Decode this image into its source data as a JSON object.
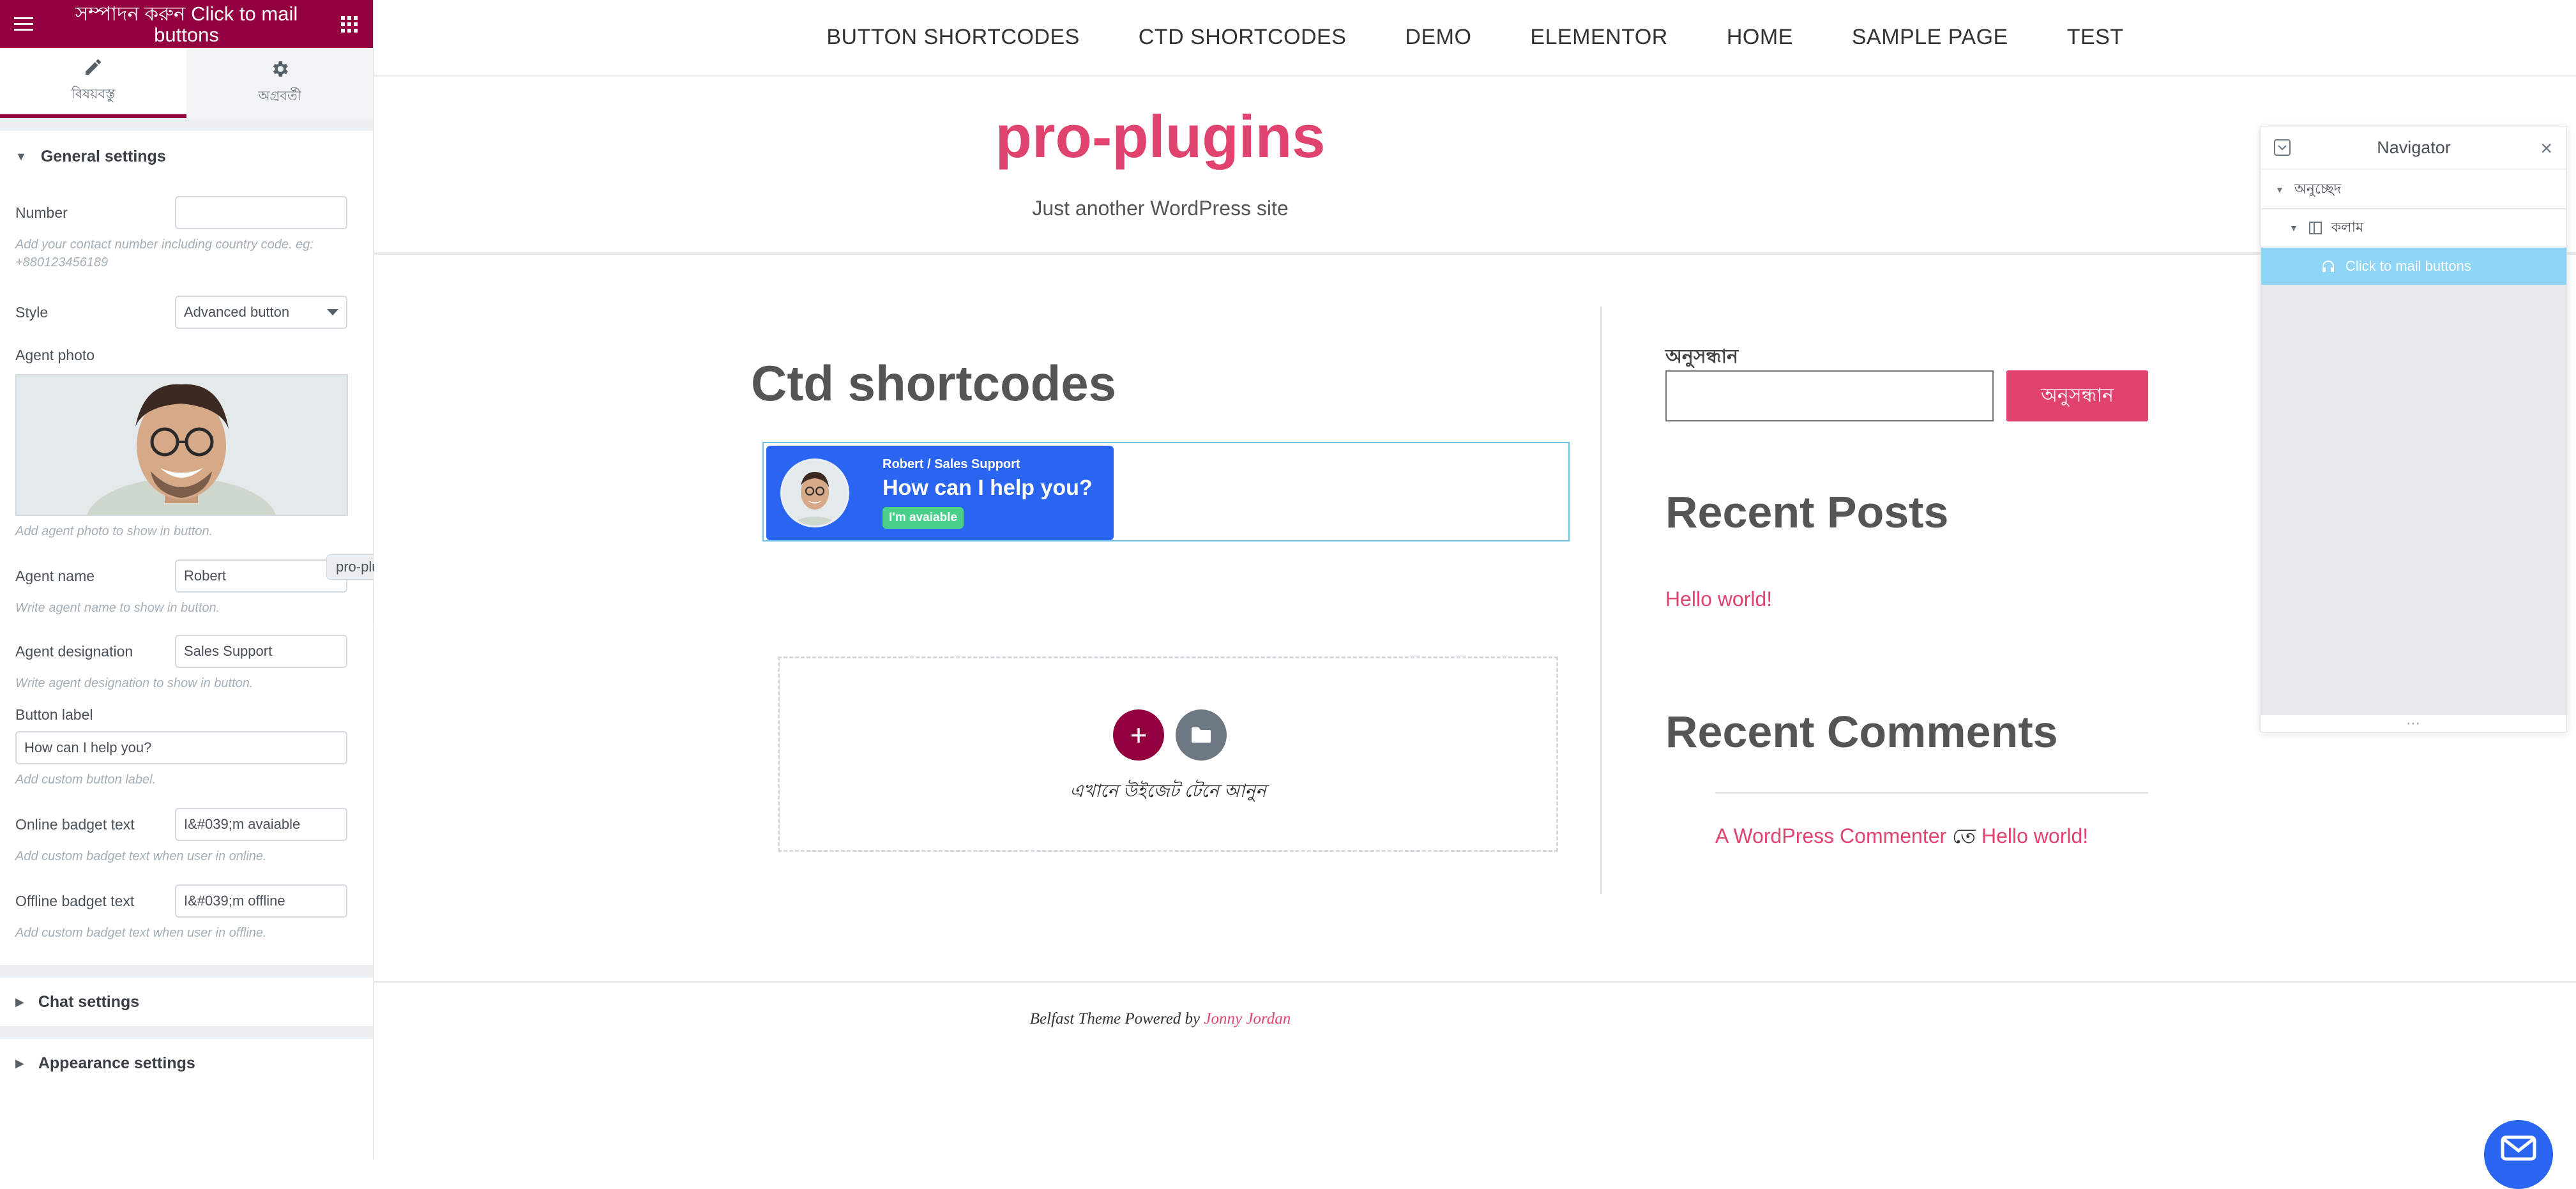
{
  "panel": {
    "title": "সম্পাদন করুন Click to mail buttons",
    "tabs": [
      {
        "label": "বিষয়বস্তু",
        "icon": "pencil-icon"
      },
      {
        "label": "অগ্রবর্তী",
        "icon": "gear-icon"
      }
    ],
    "general_section": "General settings",
    "fields": {
      "number_label": "Number",
      "number_value": "",
      "number_desc": "Add your contact number including country code. eg: +880123456189",
      "style_label": "Style",
      "style_value": "Advanced button",
      "agent_photo_label": "Agent photo",
      "agent_photo_desc": "Add agent photo to show in button.",
      "agent_name_label": "Agent name",
      "agent_name_value": "Robert",
      "agent_name_desc": "Write agent name to show in button.",
      "agent_designation_label": "Agent designation",
      "agent_designation_value": "Sales Support",
      "agent_designation_desc": "Write agent designation to show in button.",
      "button_label_label": "Button label",
      "button_label_value": "How can I help you?",
      "button_label_desc": "Add custom button label.",
      "online_label": "Online badget text",
      "online_value": "I&#039;m avaiable",
      "online_desc": "Add custom badget text when user in online.",
      "offline_label": "Offline badget text",
      "offline_value": "I&#039;m offline",
      "offline_desc": "Add custom badget text when user in offline."
    },
    "chat_section": "Chat settings",
    "appearance_section": "Appearance settings",
    "tooltip": "pro-plugins"
  },
  "site": {
    "nav": [
      "BUTTON SHORTCODES",
      "CTD SHORTCODES",
      "DEMO",
      "ELEMENTOR",
      "HOME",
      "SAMPLE PAGE",
      "TEST"
    ],
    "title": "pro-plugins",
    "tagline": "Just another WordPress site",
    "page_heading": "Ctd shortcodes",
    "ctd_button": {
      "agent_line": "Robert / Sales Support",
      "label": "How can I help you?",
      "badge": "I'm avaiable"
    },
    "drop_text": "এখানে উইজেট টেনে আনুন",
    "search_title": "অনুসন্ধান",
    "search_button": "অনুসন্ধান",
    "recent_posts_title": "Recent Posts",
    "post_link": "Hello world!",
    "recent_comments_title": "Recent Comments",
    "comment_author": "A WordPress Commenter",
    "comment_on": "তে",
    "comment_post": "Hello world!",
    "footer_prefix": "Belfast Theme Powered by",
    "footer_author": "Jonny Jordan"
  },
  "navigator": {
    "title": "Navigator",
    "items": [
      {
        "label": "অনুচ্ছেদ"
      },
      {
        "label": "কলাম"
      },
      {
        "label": "Click to mail buttons"
      }
    ]
  },
  "colors": {
    "elementor_brand": "#93003f",
    "site_accent": "#e0436e",
    "ctd_blue": "#2965f1",
    "badge_green": "#4bd08b",
    "selected_nav": "#8fd6f6"
  }
}
